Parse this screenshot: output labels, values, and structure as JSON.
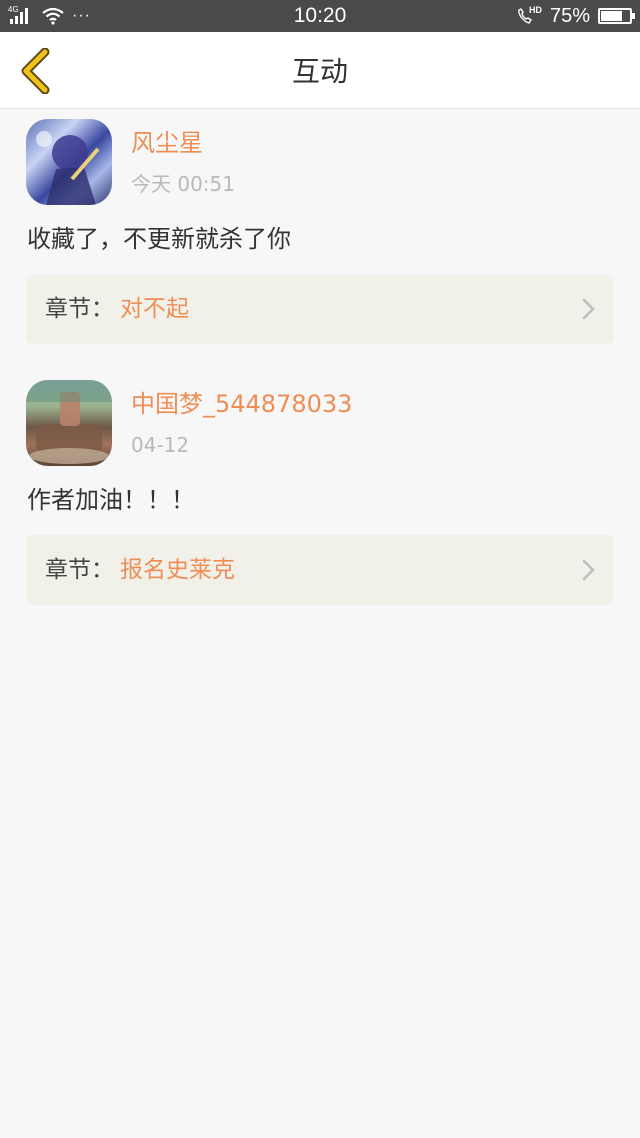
{
  "status_bar": {
    "network_label": "4G",
    "more_indicator": "···",
    "time": "10:20",
    "hd_label": "HD",
    "battery_percent": "75%",
    "battery_level": 0.75
  },
  "header": {
    "title": "互动",
    "back_icon": "chevron-left-icon"
  },
  "comments": [
    {
      "username": "风尘星",
      "time": "今天 00:51",
      "text": "收藏了，不更新就杀了你",
      "chapter_label": "章节：",
      "chapter_name": "对不起"
    },
    {
      "username": "中国梦_544878033",
      "time": "04-12",
      "text": "作者加油！！！",
      "chapter_label": "章节：",
      "chapter_name": "报名史莱克"
    }
  ],
  "colors": {
    "accent": "#ee8e55",
    "status_bar_bg": "#4a4a4a",
    "back_icon": "#f2c21b",
    "card_bg": "#f1f1ea",
    "page_bg": "#f7f7f7"
  }
}
